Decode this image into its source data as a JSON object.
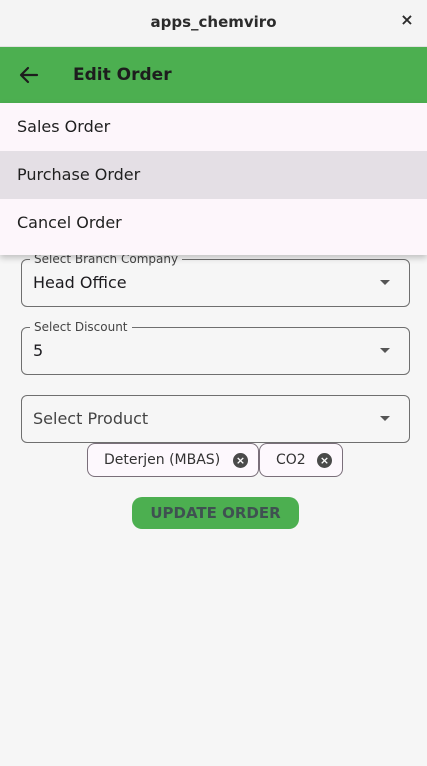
{
  "window": {
    "title": "apps_chemviro",
    "close_icon": "×"
  },
  "appbar": {
    "title": "Edit Order"
  },
  "menu": {
    "items": [
      "Sales Order",
      "Purchase Order",
      "Cancel Order"
    ],
    "highlighted": "Purchase Order"
  },
  "form": {
    "branch": {
      "label": "Select Branch Company",
      "value": "Head Office"
    },
    "discount": {
      "label": "Select Discount",
      "value": "5"
    },
    "product": {
      "placeholder": "Select Product"
    }
  },
  "chips": [
    "Deterjen (MBAS)",
    "CO2"
  ],
  "update_button": "UPDATE ORDER",
  "colors": {
    "accent": "#4caf50",
    "menu_bg": "#fdf6fb",
    "menu_highlight": "#e4dfe5"
  }
}
